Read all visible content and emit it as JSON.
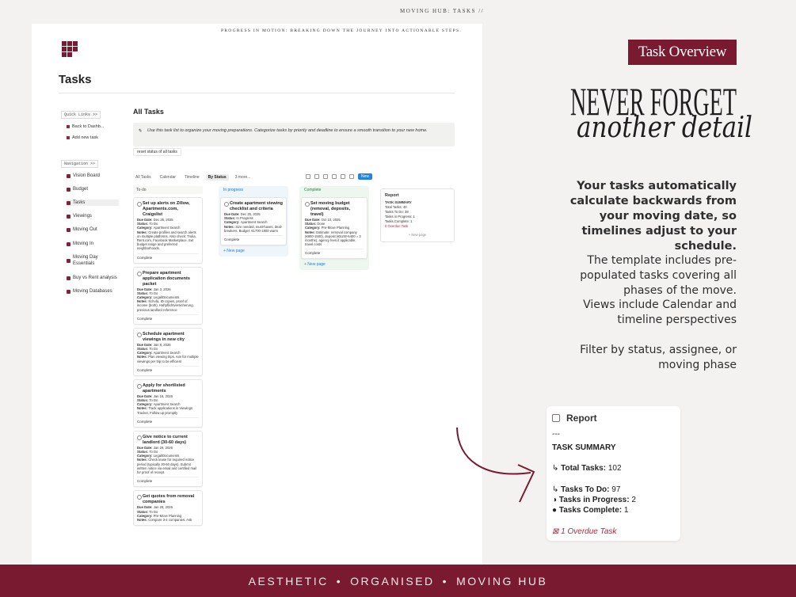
{
  "top_label": "MOVING HUB: TASKS //",
  "screenshot": {
    "subtitle": "PROGRESS IN MOTION: BREAKING DOWN THE JOURNEY INTO ACTIONABLE STEPS.",
    "page_title": "Tasks",
    "sidebar": {
      "quick_links_title": "Quick Links >>",
      "quick_links": [
        "Back to Dashb...",
        "Add new task"
      ],
      "navigation_title": "Navigation >>",
      "nav_items": [
        "Vision Board",
        "Budget",
        "Tasks",
        "Viewings",
        "Moving Out",
        "Moving In",
        "Moving Day Essentials",
        "Buy vs Rent analysis",
        "Moving Databases"
      ]
    },
    "section_title": "All Tasks",
    "callout_icon": "✎",
    "callout_text": "Use this task list to organize your moving preparations. Categorize tasks by priority and deadline to ensure a smooth transition to your new home.",
    "reset_label": "reset status of all tasks",
    "views": [
      "All Tasks",
      "Calendar",
      "Timeline",
      "By Status",
      "3 more..."
    ],
    "new_label": "New",
    "columns": [
      {
        "label": "To-do",
        "cards": [
          {
            "title": "Set up alerts on Zillow, Apartments.com, Craigslist",
            "due": "Dec 26, 2025",
            "status": "To Do",
            "category": "Apartment Search",
            "notes": "Create profiles and search alerts on multiple platforms. Also check: Trulia, Rent.com, Facebook Marketplace. Set budget range and preferred neighborhoods.",
            "action": "Complete"
          },
          {
            "title": "Prepare apartment application documents packet",
            "due": "Jan 3, 2026",
            "status": "To Do",
            "category": "Legal/Documents",
            "notes": "Schufa, ID copies, proof of income (both), Haftpflichtversicherung, previous landlord reference",
            "action": "Complete"
          },
          {
            "title": "Schedule apartment viewings in new city",
            "due": "Jan 8, 2026",
            "status": "To Do",
            "category": "Apartment Search",
            "notes": "Plan viewing trips. Aim for multiple viewings per trip to be efficient",
            "action": "Complete"
          },
          {
            "title": "Apply for shortlisted apartments",
            "due": "Jan 18, 2026",
            "status": "To Do",
            "category": "Apartment Search",
            "notes": "Track applications in Viewings Tracker. Follow up promptly",
            "action": "Complete"
          },
          {
            "title": "Give notice to current landlord (30-60 days)",
            "due": "Jan 29, 2026",
            "status": "To Do",
            "category": "Legal/Documents",
            "notes": "Check lease for required notice period (typically 30-60 days). Submit written notice via email and certified mail for proof of receipt.",
            "action": "Complete"
          },
          {
            "title": "Get quotes from removal companies",
            "due": "Jan 29, 2026",
            "status": "To Do",
            "category": "Pre-Move Planning",
            "notes": "Compare 3-4 companies. Ask",
            "action": ""
          }
        ]
      },
      {
        "label": "In progress",
        "cards": [
          {
            "title": "Create apartment viewing checklist and criteria",
            "due": "Dec 25, 2025",
            "status": "In Progress",
            "category": "Apartment Search",
            "notes": "Size needed, must-haves, deal-breakers. Budget: €1700-1800 warm",
            "action": "Complete"
          }
        ],
        "new_page": "+ New page"
      },
      {
        "label": "Complete",
        "cards": [
          {
            "title": "Set moving budget (removal, deposits, travel)",
            "due": "Oct 10, 2025",
            "status": "Done",
            "category": "Pre-Move Planning",
            "notes": "Estimate: removal company (€800-1500), deposit (€5100-5400 = 3 months), agency fees if applicable, travel costs",
            "action": "Complete"
          }
        ],
        "new_page": "+ New page"
      }
    ],
    "report": {
      "title": "Report",
      "summary": "TASK SUMMARY",
      "total": "Total Tasks: 40",
      "todo": "Tasks To Do: 38",
      "in_progress": "Tasks in Progress: 1",
      "complete": "Tasks Complete: 1",
      "overdue": "0 Overdue Task",
      "new_page": "+ New page"
    }
  },
  "header_label": "Task Overview",
  "headline_line1": "NEVER FORGET",
  "headline_line2": "another detail",
  "description_1": "Your tasks automatically calculate backwards from your moving date, so timelines adjust to your schedule.",
  "description_2": "The template includes pre-populated tasks covering all phases of the move.",
  "description_3": "Views include Calendar and timeline perspectives",
  "description_4": "Filter by status, assignee, or moving phase",
  "report_detail": {
    "title": "Report",
    "dashes": "---",
    "summary": "TASK SUMMARY",
    "total_label": "Total Tasks:",
    "total_value": "102",
    "todo_label": "Tasks To Do:",
    "todo_value": "97",
    "inprog_label": "Tasks in Progress:",
    "inprog_value": "2",
    "complete_label": "Tasks Complete:",
    "complete_value": "1",
    "overdue": "1 Overdue Task"
  },
  "footer": [
    "AESTHETIC",
    "ORGANISED",
    "MOVING HUB"
  ],
  "footer_sep": "•",
  "colors": {
    "accent": "#7a1a30",
    "background": "#f4f2f1"
  }
}
